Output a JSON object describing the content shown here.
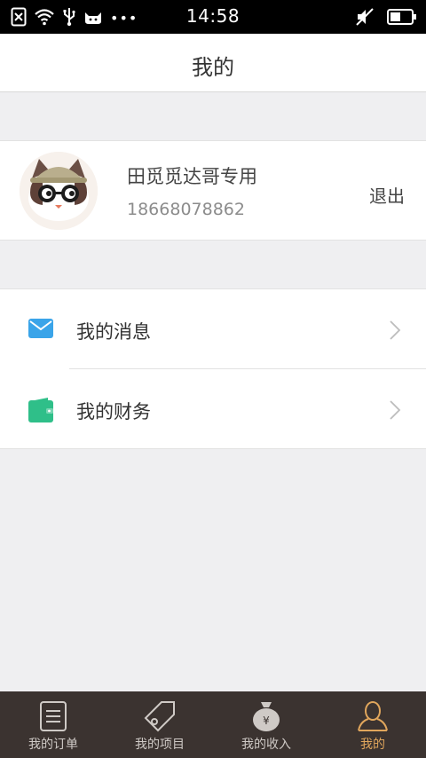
{
  "status_bar": {
    "time": "14:58"
  },
  "header": {
    "title": "我的"
  },
  "profile": {
    "name": "田觅觅达哥专用",
    "phone": "18668078862",
    "logout_label": "退出"
  },
  "menu": {
    "items": [
      {
        "label": "我的消息",
        "icon": "mail-icon",
        "icon_color": "#3aa4e9"
      },
      {
        "label": "我的财务",
        "icon": "wallet-icon",
        "icon_color": "#2fbf89"
      }
    ]
  },
  "tabbar": {
    "active_color": "#e0a65c",
    "tabs": [
      {
        "label": "我的订单",
        "icon": "document-icon"
      },
      {
        "label": "我的项目",
        "icon": "tag-icon"
      },
      {
        "label": "我的收入",
        "icon": "money-bag-icon"
      },
      {
        "label": "我的",
        "icon": "person-icon",
        "active": true
      }
    ]
  }
}
